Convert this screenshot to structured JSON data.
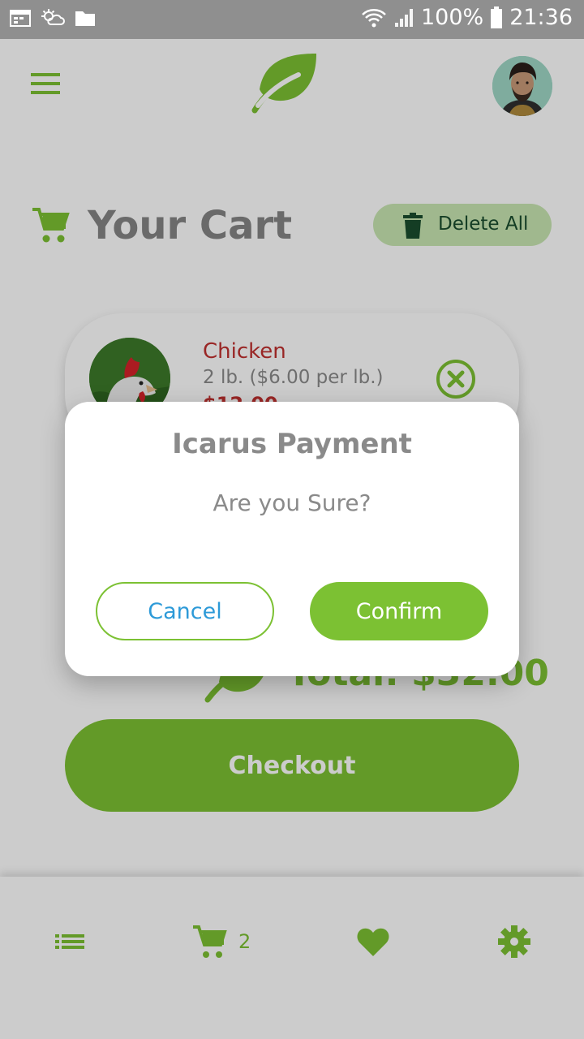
{
  "status_bar": {
    "battery": "100%",
    "time": "21:36"
  },
  "header": {
    "menu_icon": "hamburger-menu-icon",
    "logo_icon": "leaf-icon",
    "avatar_icon": "user-avatar"
  },
  "cart": {
    "title": "Your Cart",
    "delete_all_label": "Delete All",
    "items": [
      {
        "name": "Chicken",
        "quantity_text": "2 lb. ($6.00 per lb.)",
        "price": "$12.00"
      }
    ],
    "total_text": "Total: $32.00",
    "checkout_label": "Checkout"
  },
  "bottom_nav": {
    "items": [
      {
        "icon": "list-icon"
      },
      {
        "icon": "cart-icon",
        "badge": "2"
      },
      {
        "icon": "heart-icon"
      },
      {
        "icon": "gear-icon"
      }
    ]
  },
  "dialog": {
    "title": "Icarus Payment",
    "message": "Are you Sure?",
    "cancel_label": "Cancel",
    "confirm_label": "Confirm"
  },
  "colors": {
    "accent": "#7cc133",
    "danger": "#c0302f",
    "link_blue": "#2d9ad8",
    "delete_bg": "#c8e6b2",
    "delete_fg": "#1a4d2e"
  }
}
